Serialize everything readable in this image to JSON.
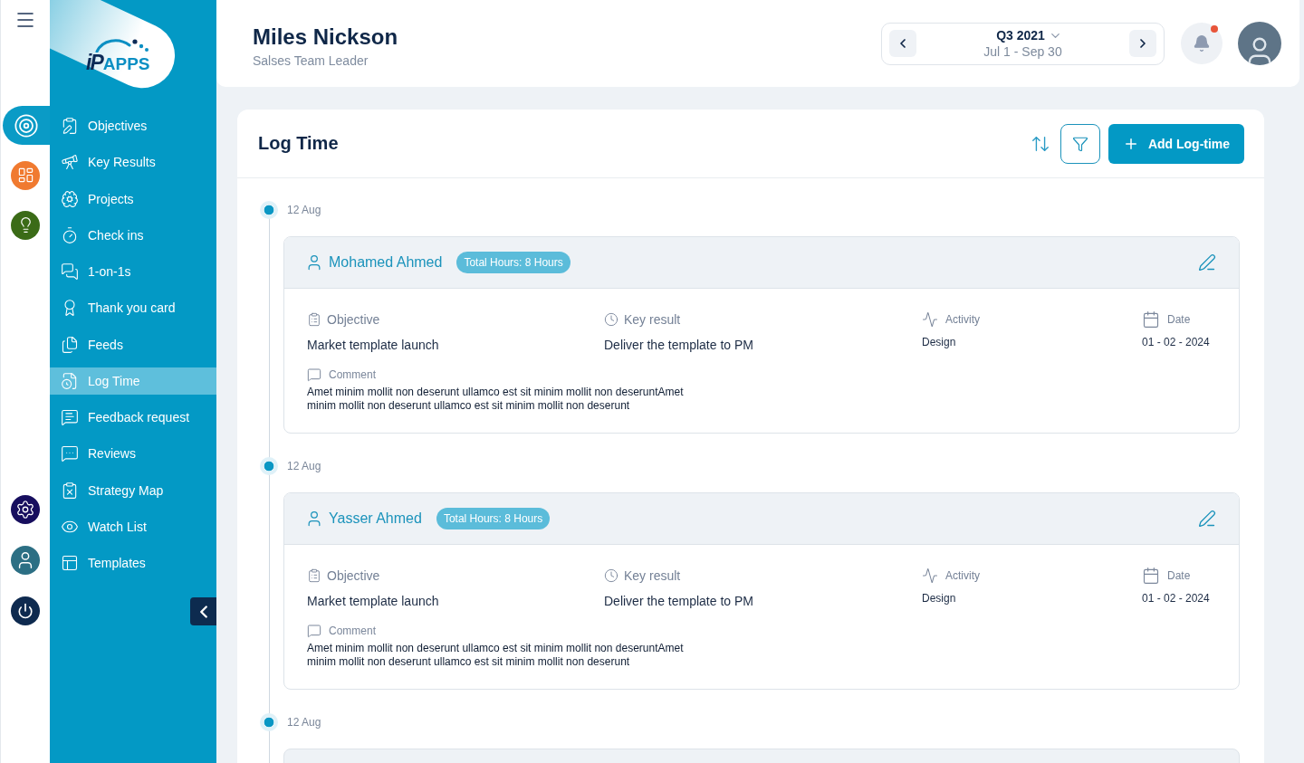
{
  "rail": {
    "apps": [
      {
        "selected": true,
        "color": "#0a9bc6"
      },
      {
        "selected": false,
        "color": "#f07a30"
      },
      {
        "selected": false,
        "color": "#3b6b17"
      }
    ]
  },
  "sidebar": {
    "logo": {
      "mark": "iP",
      "wordmark": "APPS"
    },
    "items": [
      {
        "label": "Objectives",
        "selected": false
      },
      {
        "label": "Key Results",
        "selected": false
      },
      {
        "label": "Projects",
        "selected": false
      },
      {
        "label": "Check ins",
        "selected": false
      },
      {
        "label": "1-on-1s",
        "selected": false
      },
      {
        "label": "Thank you card",
        "selected": false
      },
      {
        "label": "Feeds",
        "selected": false
      },
      {
        "label": "Log Time",
        "selected": true
      },
      {
        "label": "Feedback request",
        "selected": false
      },
      {
        "label": "Reviews",
        "selected": false
      },
      {
        "label": "Strategy Map",
        "selected": false
      },
      {
        "label": "Watch List",
        "selected": false
      },
      {
        "label": "Templates",
        "selected": false
      }
    ]
  },
  "header": {
    "user": {
      "name": "Miles Nickson",
      "role": "Salses Team Leader"
    },
    "period": {
      "quarter": "Q3 2021",
      "range": "Jul 1 - Sep 30"
    },
    "notifications": {
      "unread": true
    }
  },
  "log_time": {
    "title": "Log Time",
    "add_button": "Add Log-time",
    "entries": [
      {
        "date": "12 Aug",
        "user": "Mohamed Ahmed",
        "total_hours": "Total Hours: 8 Hours",
        "fields": [
          {
            "label": "Objective",
            "value": "Market template launch"
          },
          {
            "label": "Key result",
            "value": "Deliver the template to PM"
          },
          {
            "label": "Activity",
            "value": "Design"
          },
          {
            "label": "Date",
            "value": "01 - 02 - 2024"
          }
        ],
        "comment_label": "Comment",
        "comment": "Amet minim mollit non deserunt ullamco est sit minim mollit non deseruntAmet minim mollit non deserunt ullamco est sit minim mollit non deserunt"
      },
      {
        "date": "12 Aug",
        "user": "Yasser Ahmed",
        "total_hours": "Total Hours: 8 Hours",
        "fields": [
          {
            "label": "Objective",
            "value": "Market template launch"
          },
          {
            "label": "Key result",
            "value": "Deliver the template to PM"
          },
          {
            "label": "Activity",
            "value": "Design"
          },
          {
            "label": "Date",
            "value": "01 - 02 - 2024"
          }
        ],
        "comment_label": "Comment",
        "comment": "Amet minim mollit non deserunt ullamco est sit minim mollit non deseruntAmet minim mollit non deserunt ullamco est sit minim mollit non deserunt"
      },
      {
        "date": "12 Aug"
      }
    ]
  }
}
